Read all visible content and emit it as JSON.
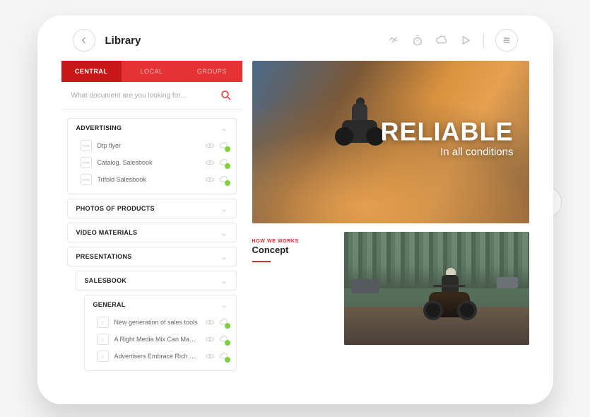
{
  "header": {
    "title": "Library"
  },
  "tabs": {
    "central": "CENTRAL",
    "local": "LOCAL",
    "groups": "GROUPS",
    "active": "central"
  },
  "search": {
    "placeholder": "What document are you looking for..."
  },
  "categories": {
    "advertising": {
      "label": "ADVERTISING",
      "docs": [
        {
          "label": "Dtp flyer"
        },
        {
          "label": "Catalog. Salesbook"
        },
        {
          "label": "Trifold Salesbook"
        }
      ]
    },
    "photos": {
      "label": "PHOTOS OF PRODUCTS"
    },
    "video": {
      "label": "VIDEO MATERIALS"
    },
    "presentations": {
      "label": "PRESENTATIONS"
    },
    "salesbook": {
      "label": "SALESBOOK"
    },
    "general": {
      "label": "GENERAL",
      "docs": [
        {
          "label": "New generation of sales tools"
        },
        {
          "label": "A Right Media Mix Can Make ..."
        },
        {
          "label": "Advertisers Embrace Rich Me..."
        }
      ]
    }
  },
  "hero": {
    "title": "RELIABLE",
    "subtitle": "In all conditions"
  },
  "concept": {
    "eyebrow": "HOW WE WORKS",
    "title": "Concept"
  },
  "colors": {
    "accent": "#e63232",
    "success": "#7fcf3f"
  }
}
